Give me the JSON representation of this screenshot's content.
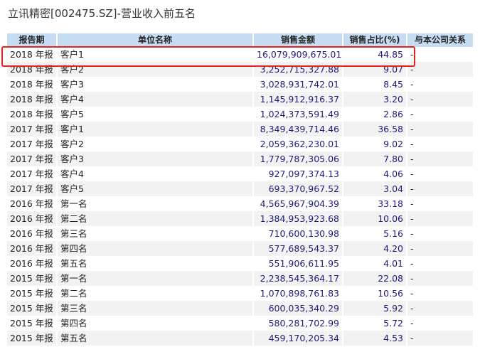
{
  "title": "立讯精密[002475.SZ]-营业收入前五名",
  "headers": [
    "报告期",
    "单位名称",
    "销售金额",
    "销售占比(%)",
    "与本公司关系"
  ],
  "rows": [
    {
      "period": "2018 年报",
      "name": "客户1",
      "amount": "16,079,909,675.01",
      "pct": "44.85",
      "rel": "-"
    },
    {
      "period": "2018 年报",
      "name": "客户2",
      "amount": "3,252,715,327.88",
      "pct": "9.07",
      "rel": "-"
    },
    {
      "period": "2018 年报",
      "name": "客户3",
      "amount": "3,028,931,742.01",
      "pct": "8.45",
      "rel": "-"
    },
    {
      "period": "2018 年报",
      "name": "客户4",
      "amount": "1,145,912,916.37",
      "pct": "3.20",
      "rel": "-"
    },
    {
      "period": "2018 年报",
      "name": "客户5",
      "amount": "1,024,373,591.49",
      "pct": "2.86",
      "rel": "-"
    },
    {
      "period": "2017 年报",
      "name": "客户1",
      "amount": "8,349,439,714.46",
      "pct": "36.58",
      "rel": "-"
    },
    {
      "period": "2017 年报",
      "name": "客户2",
      "amount": "2,059,362,230.01",
      "pct": "9.02",
      "rel": "-"
    },
    {
      "period": "2017 年报",
      "name": "客户3",
      "amount": "1,779,787,305.06",
      "pct": "7.80",
      "rel": "-"
    },
    {
      "period": "2017 年报",
      "name": "客户4",
      "amount": "927,097,374.13",
      "pct": "4.06",
      "rel": "-"
    },
    {
      "period": "2017 年报",
      "name": "客户5",
      "amount": "693,370,967.52",
      "pct": "3.04",
      "rel": "-"
    },
    {
      "period": "2016 年报",
      "name": "第一名",
      "amount": "4,565,967,904.39",
      "pct": "33.18",
      "rel": "-"
    },
    {
      "period": "2016 年报",
      "name": "第二名",
      "amount": "1,384,953,923.68",
      "pct": "10.06",
      "rel": "-"
    },
    {
      "period": "2016 年报",
      "name": "第三名",
      "amount": "710,600,130.98",
      "pct": "5.16",
      "rel": "-"
    },
    {
      "period": "2016 年报",
      "name": "第四名",
      "amount": "577,689,543.37",
      "pct": "4.20",
      "rel": "-"
    },
    {
      "period": "2016 年报",
      "name": "第五名",
      "amount": "551,906,611.95",
      "pct": "4.01",
      "rel": "-"
    },
    {
      "period": "2015 年报",
      "name": "第一名",
      "amount": "2,238,545,364.17",
      "pct": "22.08",
      "rel": "-"
    },
    {
      "period": "2015 年报",
      "name": "第二名",
      "amount": "1,070,898,761.83",
      "pct": "10.56",
      "rel": "-"
    },
    {
      "period": "2015 年报",
      "name": "第三名",
      "amount": "600,035,340.29",
      "pct": "5.92",
      "rel": "-"
    },
    {
      "period": "2015 年报",
      "name": "第四名",
      "amount": "580,281,702.99",
      "pct": "5.72",
      "rel": "-"
    },
    {
      "period": "2015 年报",
      "name": "第五名",
      "amount": "459,170,205.34",
      "pct": "4.53",
      "rel": "-"
    }
  ],
  "colors": {
    "header_bg": "#c5dcf2",
    "highlight": "#e8231e",
    "number": "#1c1c78"
  }
}
